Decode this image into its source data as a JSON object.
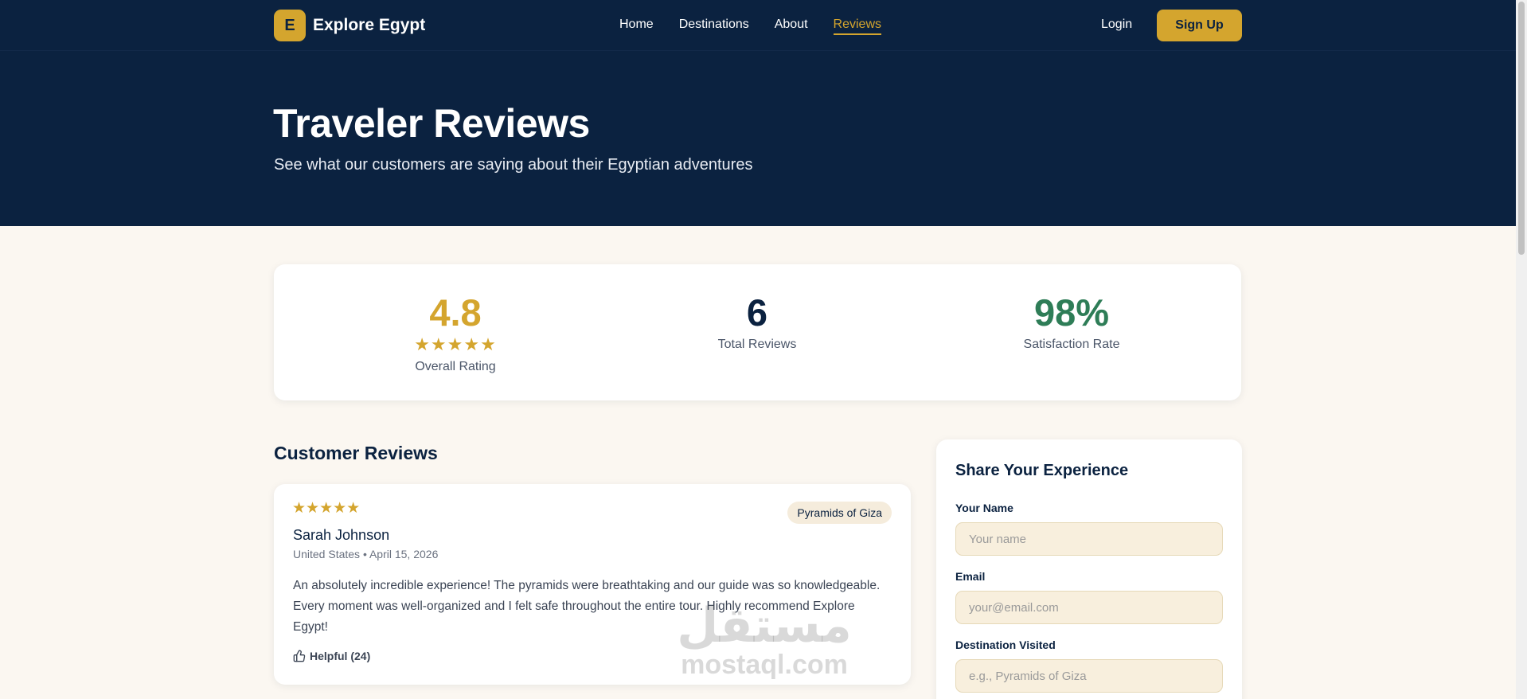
{
  "nav": {
    "logo_letter": "E",
    "brand": "Explore Egypt",
    "links": [
      "Home",
      "Destinations",
      "About",
      "Reviews"
    ],
    "active": "Reviews",
    "login": "Login",
    "signup": "Sign Up"
  },
  "hero": {
    "title": "Traveler Reviews",
    "subtitle": "See what our customers are saying about their Egyptian adventures"
  },
  "stats": {
    "rating": {
      "value": "4.8",
      "stars": "★★★★★",
      "label": "Overall Rating"
    },
    "total": {
      "value": "6",
      "label": "Total Reviews"
    },
    "satisfaction": {
      "value": "98%",
      "label": "Satisfaction Rate"
    }
  },
  "reviews": {
    "title": "Customer Reviews",
    "items": [
      {
        "stars": "★★★★★",
        "tag": "Pyramids of Giza",
        "name": "Sarah Johnson",
        "meta": "United States • April 15, 2026",
        "text": "An absolutely incredible experience! The pyramids were breathtaking and our guide was so knowledgeable. Every moment was well-organized and I felt safe throughout the entire tour. Highly recommend Explore Egypt!",
        "helpful": "Helpful (24)"
      }
    ]
  },
  "form": {
    "title": "Share Your Experience",
    "name_label": "Your Name",
    "name_placeholder": "Your name",
    "email_label": "Email",
    "email_placeholder": "your@email.com",
    "destination_label": "Destination Visited",
    "destination_placeholder": "e.g., Pyramids of Giza"
  },
  "watermark": {
    "arabic": "مستقل",
    "latin": "mostaql.com"
  },
  "colors": {
    "navy": "#0b2240",
    "gold": "#d4a52e",
    "green": "#2e7d57",
    "cream": "#fbf7f1"
  }
}
